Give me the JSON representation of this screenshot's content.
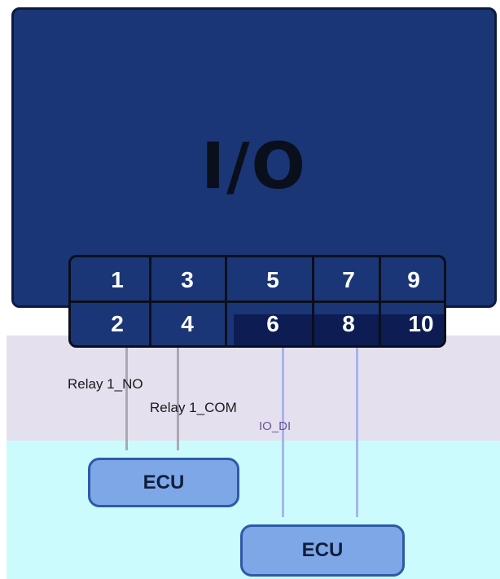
{
  "io_box": {
    "title": "I/O"
  },
  "terminals": {
    "top_row": [
      "1",
      "3",
      "5",
      "7",
      "9"
    ],
    "bottom_row": [
      "2",
      "4",
      "6",
      "8",
      "10"
    ]
  },
  "labels": {
    "relay_no": "Relay 1_NO",
    "relay_com": "Relay 1_COM",
    "garbled": "IO_DI"
  },
  "ecus": [
    {
      "label": "ECU"
    },
    {
      "label": "ECU"
    }
  ],
  "colors": {
    "io_fill": "#1a3676",
    "border": "#0a0f1c",
    "ecu_fill": "#7ea7e8",
    "ecu_border": "#2d5aa7",
    "band_lavender": "#e5e0ee",
    "band_cyan": "#ccfbfd"
  }
}
